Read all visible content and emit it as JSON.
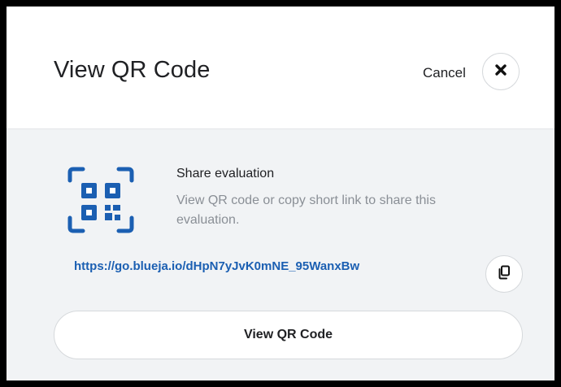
{
  "dialog": {
    "title": "View QR Code",
    "cancel_label": "Cancel",
    "close_icon": "close-icon"
  },
  "share": {
    "icon": "qr-code-icon",
    "title": "Share evaluation",
    "description": "View QR code or copy short link to share this evaluation.",
    "short_link": "https://go.blueja.io/dHpN7yJvK0mNE_95WanxBw",
    "copy_icon": "copy-icon"
  },
  "actions": {
    "view_qr_label": "View QR Code"
  },
  "colors": {
    "accent": "#1b5fb2",
    "background_panel": "#f1f3f5",
    "muted_text": "#8a8f96"
  }
}
